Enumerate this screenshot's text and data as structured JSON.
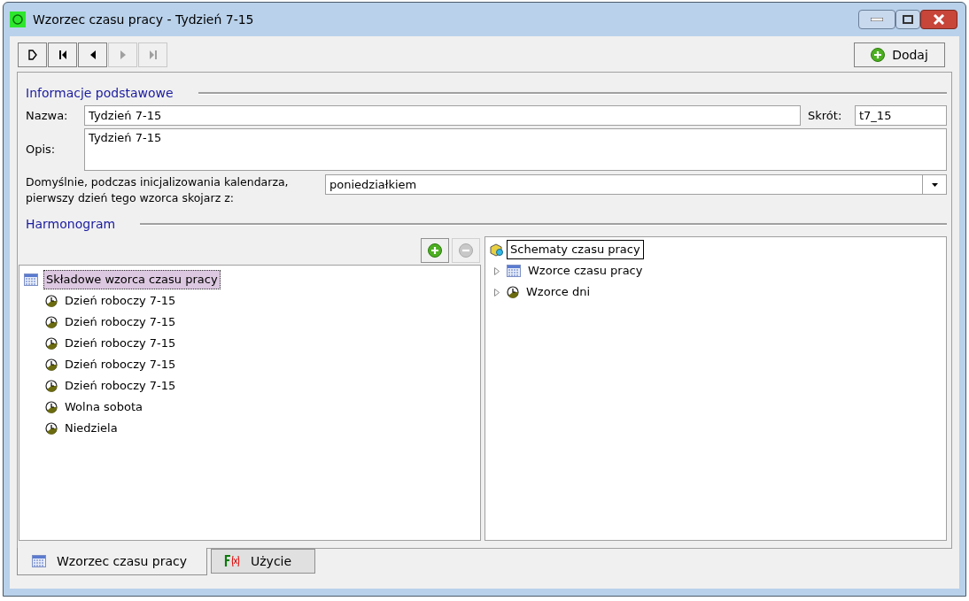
{
  "window": {
    "title": "Wzorzec czasu pracy - Tydzień 7-15"
  },
  "nav_buttons": [
    {
      "kind": "new",
      "disabled": false
    },
    {
      "kind": "first",
      "disabled": false
    },
    {
      "kind": "prev",
      "disabled": false
    },
    {
      "kind": "next",
      "disabled": true
    },
    {
      "kind": "last",
      "disabled": true
    }
  ],
  "add_button": {
    "label": "Dodaj"
  },
  "basic_info": {
    "heading": "Informacje podstawowe",
    "name_label": "Nazwa:",
    "name_value": "Tydzień 7-15",
    "short_label": "Skrót:",
    "short_value": "t7_15",
    "description_label": "Opis:",
    "description_value": "Tydzień 7-15",
    "first_day_label": "Domyślnie, podczas inicjalizowania kalendarza, pierwszy dzień tego wzorca skojarz z:",
    "first_day_value": "poniedziałkiem"
  },
  "schedule": {
    "heading": "Harmonogram",
    "remove_disabled": true,
    "left_tree": {
      "label": "Składowe wzorca czasu pracy",
      "selected": true,
      "children": [
        {
          "label": "Dzień roboczy 7-15"
        },
        {
          "label": "Dzień roboczy 7-15"
        },
        {
          "label": "Dzień roboczy 7-15"
        },
        {
          "label": "Dzień roboczy 7-15"
        },
        {
          "label": "Dzień roboczy 7-15"
        },
        {
          "label": "Wolna sobota"
        },
        {
          "label": "Niedziela"
        }
      ]
    },
    "right_tree": {
      "label": "Schematy czasu pracy",
      "selected": true,
      "children": [
        {
          "label": "Wzorce czasu pracy",
          "kind": "calendar",
          "expanded": false
        },
        {
          "label": "Wzorce dni",
          "kind": "clock",
          "expanded": false
        }
      ]
    }
  },
  "tabs": [
    {
      "label": "Wzorzec czasu pracy",
      "kind": "calendar",
      "selected": true
    },
    {
      "label": "Użycie",
      "kind": "function",
      "selected": false
    }
  ]
}
